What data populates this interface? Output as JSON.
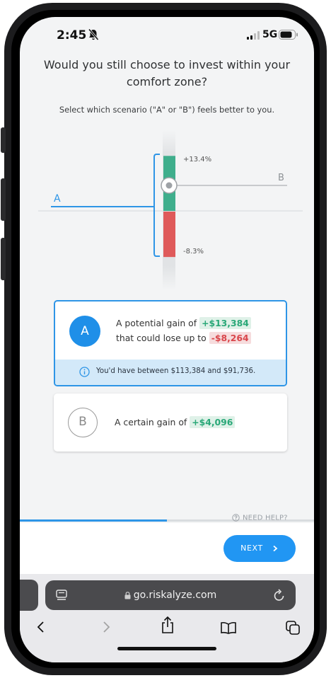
{
  "status": {
    "time": "2:45",
    "network": "5G"
  },
  "question": {
    "line1": "Would you still choose to invest within your",
    "line2": "comfort zone?"
  },
  "subtitle": "Select which scenario (\"A\" or \"B\") feels better to you.",
  "chart": {
    "upside_label": "+13.4%",
    "downside_label": "-8.3%",
    "label_a": "A",
    "label_b": "B"
  },
  "chart_data": {
    "type": "bar",
    "categories": [
      "Scenario A range"
    ],
    "series": [
      {
        "name": "",
        "values": [
          13.4
        ]
      },
      {
        "name": "",
        "values": [
          -8.3
        ]
      }
    ],
    "title": "",
    "xlabel": "",
    "ylabel": "",
    "ylim": [
      -8.3,
      13.4
    ],
    "tick_labels": [
      "+13.4%",
      "-8.3%"
    ],
    "line_labels": [
      "A",
      "B"
    ],
    "colors": [
      "#3fae8c",
      "#df5a5a"
    ]
  },
  "option_a": {
    "badge": "A",
    "line1_prefix": "A potential gain of",
    "gain": "+$13,384",
    "line2_prefix": "that could lose up to",
    "loss": "-$8,264",
    "info": "You'd have between $113,384 and $91,736."
  },
  "option_b": {
    "badge": "B",
    "prefix": "A certain gain of",
    "gain": "+$4,096"
  },
  "help_label": "NEED HELP?",
  "progress": 0.5,
  "next_label": "NEXT",
  "browser": {
    "url": "go.riskalyze.com"
  },
  "colors": {
    "accent": "#2196f3",
    "gain": "#3fae8c",
    "loss": "#df5a5a"
  },
  "icons": [
    "bell-slash-icon",
    "signal-icon",
    "battery-icon",
    "info-icon",
    "help-icon",
    "chevron-right-icon",
    "reader-icon",
    "lock-icon",
    "reload-icon",
    "back-icon",
    "forward-icon",
    "share-icon",
    "bookmarks-icon",
    "tabs-icon"
  ]
}
